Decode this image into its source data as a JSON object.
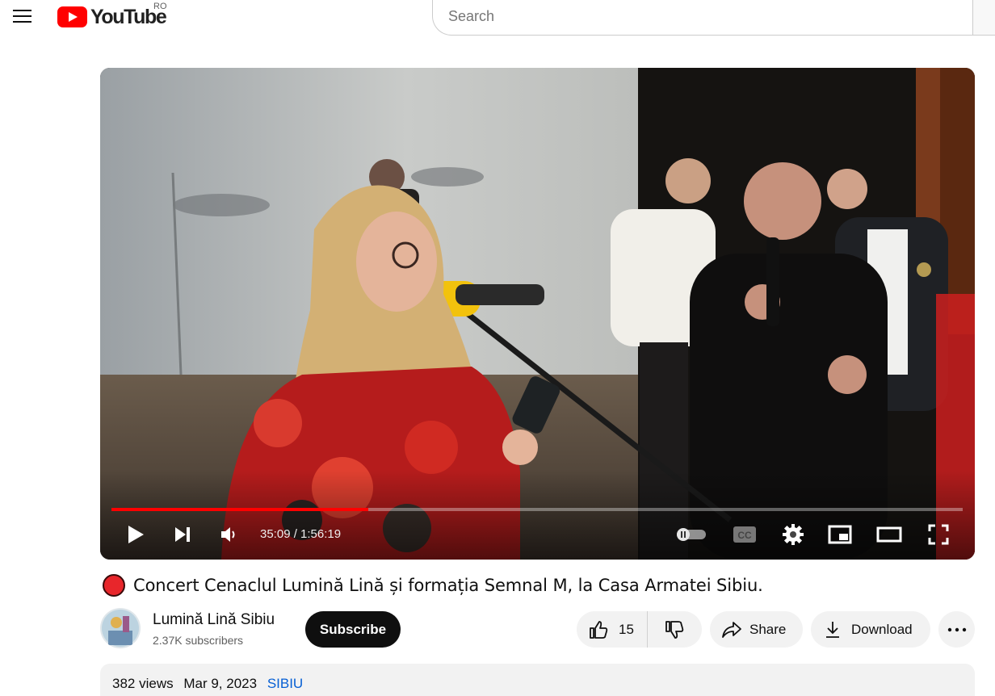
{
  "header": {
    "logo_text": "YouTube",
    "region_code": "RO",
    "search_placeholder": "Search"
  },
  "player": {
    "current_time": "35:09",
    "duration": "1:56:19",
    "time_display": "35:09 / 1:56:19",
    "progress_fraction": 0.302,
    "controls": [
      "play-icon",
      "next-icon",
      "volume-icon",
      "autoplay-toggle",
      "captions-icon",
      "settings-icon",
      "miniplayer-icon",
      "theater-icon",
      "fullscreen-icon"
    ],
    "captions_label": "CC"
  },
  "video": {
    "title": "Concert Cenaclul Lumină Lină și formația Semnal M, la Casa Armatei Sibiu.",
    "live_dot_color": "#e8262b"
  },
  "channel": {
    "name": "Lumină Lină Sibiu",
    "subscribers": "2.37K subscribers",
    "subscribe_label": "Subscribe"
  },
  "actions": {
    "like_count": "15",
    "share_label": "Share",
    "download_label": "Download"
  },
  "description": {
    "views": "382 views",
    "date": "Mar 9, 2023",
    "tag": "SIBIU"
  },
  "colors": {
    "brand_red": "#ff0000",
    "link_blue": "#065fd4",
    "pill_bg": "#f2f2f2"
  }
}
